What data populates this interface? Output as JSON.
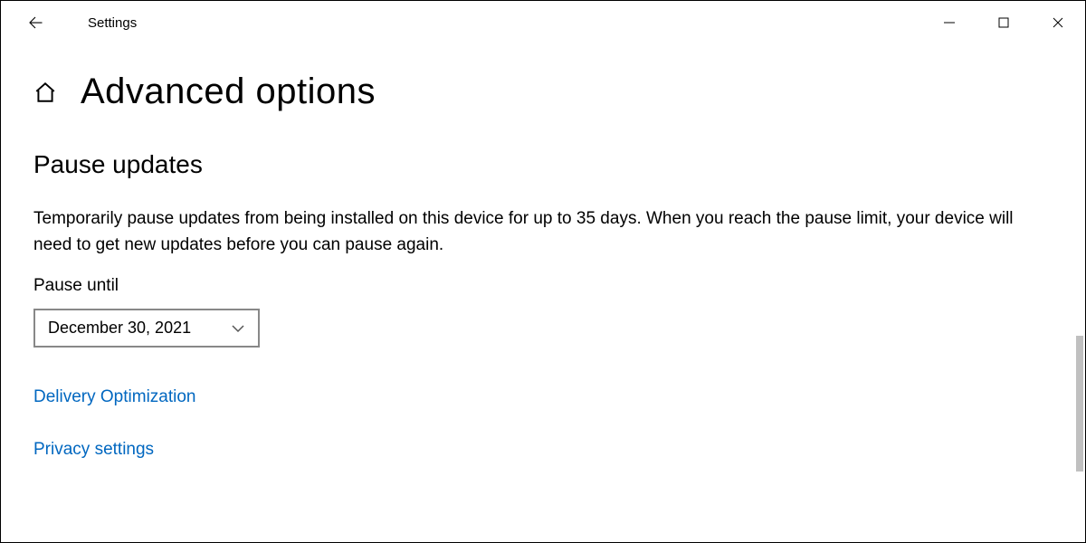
{
  "titlebar": {
    "app_title": "Settings"
  },
  "page": {
    "title": "Advanced options"
  },
  "section": {
    "heading": "Pause updates",
    "description": "Temporarily pause updates from being installed on this device for up to 35 days. When you reach the pause limit, your device will need to get new updates before you can pause again.",
    "field_label": "Pause until",
    "dropdown_value": "December 30, 2021"
  },
  "links": {
    "delivery_optimization": "Delivery Optimization",
    "privacy_settings": "Privacy settings"
  }
}
